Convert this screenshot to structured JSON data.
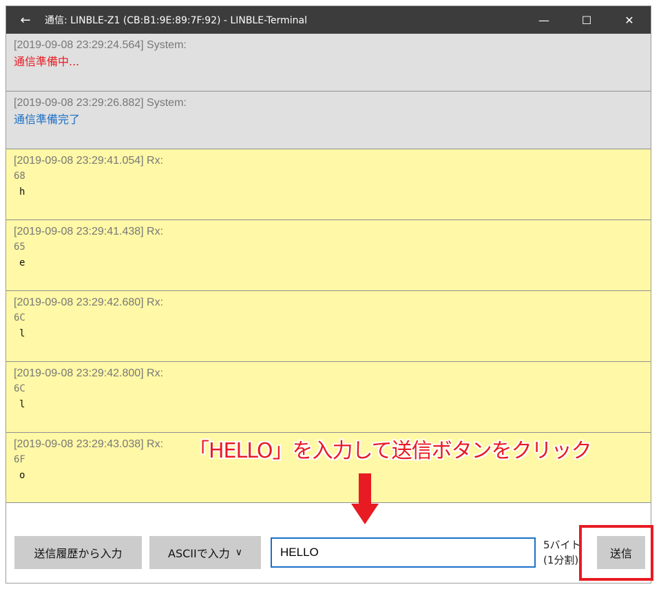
{
  "window": {
    "title": "通信: LINBLE-Z1 (CB:B1:9E:89:7F:92) - LINBLE-Terminal",
    "back_icon": "←",
    "minimize_icon": "—",
    "maximize_icon": "☐",
    "close_icon": "✕"
  },
  "log": [
    {
      "kind": "system",
      "timestamp": "[2019-09-08 23:29:24.564]  System:",
      "message": "通信準備中..."
    },
    {
      "kind": "system",
      "timestamp": "[2019-09-08 23:29:26.882]  System:",
      "message": "通信準備完了"
    },
    {
      "kind": "rx",
      "timestamp": "[2019-09-08 23:29:41.054]  Rx:",
      "hex": "68",
      "ascii": "h"
    },
    {
      "kind": "rx",
      "timestamp": "[2019-09-08 23:29:41.438]  Rx:",
      "hex": "65",
      "ascii": "e"
    },
    {
      "kind": "rx",
      "timestamp": "[2019-09-08 23:29:42.680]  Rx:",
      "hex": "6C",
      "ascii": "l"
    },
    {
      "kind": "rx",
      "timestamp": "[2019-09-08 23:29:42.800]  Rx:",
      "hex": "6C",
      "ascii": "l"
    },
    {
      "kind": "rx",
      "timestamp": "[2019-09-08 23:29:43.038]  Rx:",
      "hex": "6F",
      "ascii": "o"
    }
  ],
  "annotation": {
    "text": "「HELLO」を入力して送信ボタンをクリック",
    "color": "#e81b22"
  },
  "bottom": {
    "history_button": "送信履歴から入力",
    "mode_button": "ASCIIで入力",
    "mode_chevron": "∨",
    "input_value": "HELLO",
    "byte_count_line1": "5バイト",
    "byte_count_line2": "(1分割)",
    "send_button": "送信"
  },
  "colors": {
    "titlebar": "#3c3c3c",
    "system_bg": "#e0e0e0",
    "rx_bg": "#fff8a6",
    "status_red": "#e81b22",
    "status_blue": "#1a6fc7",
    "accent": "#1a6fc7"
  }
}
